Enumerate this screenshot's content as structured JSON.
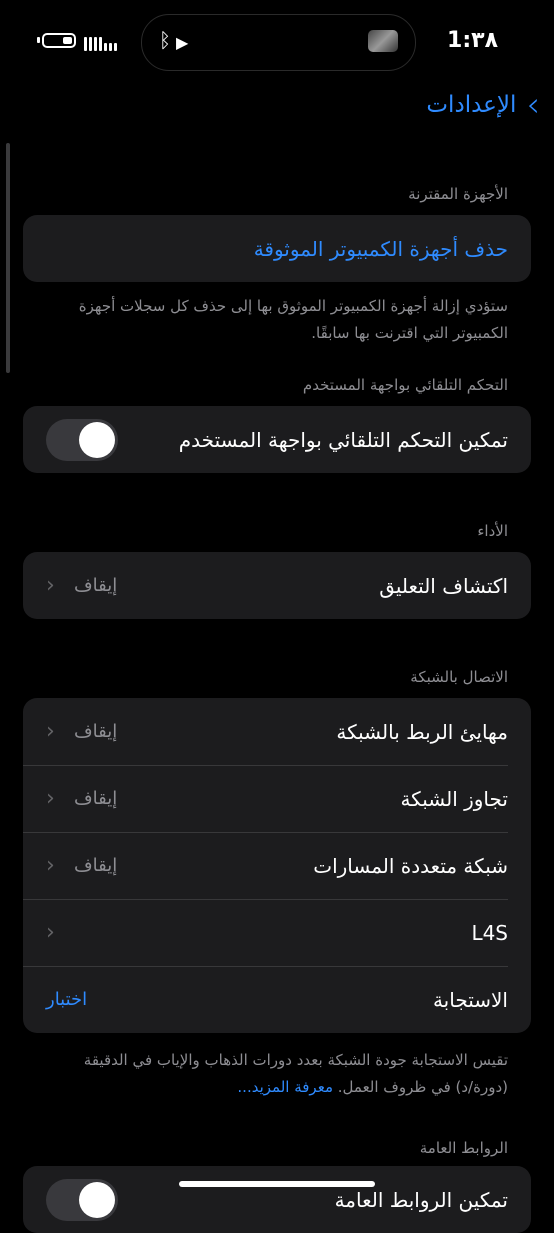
{
  "status": {
    "time": "1:٣٨"
  },
  "nav": {
    "back_label": "الإعدادات"
  },
  "paired": {
    "header": "الأجهزة المقترنة",
    "action": "حذف أجهزة الكمبيوتر الموثوقة",
    "footer": "ستؤدي إزالة أجهزة الكمبيوتر الموثوق بها إلى حذف كل سجلات أجهزة الكمبيوتر التي اقترنت بها سابقًا."
  },
  "ui_automation": {
    "header": "التحكم التلقائي بواجهة المستخدم",
    "toggle_label": "تمكين التحكم التلقائي بواجهة المستخدم",
    "enabled": false
  },
  "performance": {
    "header": "الأداء",
    "rows": [
      {
        "label": "اكتشاف التعليق",
        "value": "إيقاف"
      }
    ]
  },
  "network": {
    "header": "الاتصال بالشبكة",
    "rows": [
      {
        "label": "مهايئ الربط بالشبكة",
        "value": "إيقاف"
      },
      {
        "label": "تجاوز الشبكة",
        "value": "إيقاف"
      },
      {
        "label": "شبكة متعددة المسارات",
        "value": "إيقاف"
      },
      {
        "label": "L4S",
        "value": ""
      }
    ],
    "responsiveness": {
      "label": "الاستجابة",
      "action": "اختبار"
    },
    "footer": "تقيس الاستجابة جودة الشبكة بعدد دورات الذهاب والإياب في الدقيقة (دورة/د) في ظروف العمل.",
    "learn_more": "معرفة المزيد..."
  },
  "public_links": {
    "header": "الروابط العامة",
    "toggle_label": "تمكين الروابط العامة"
  }
}
